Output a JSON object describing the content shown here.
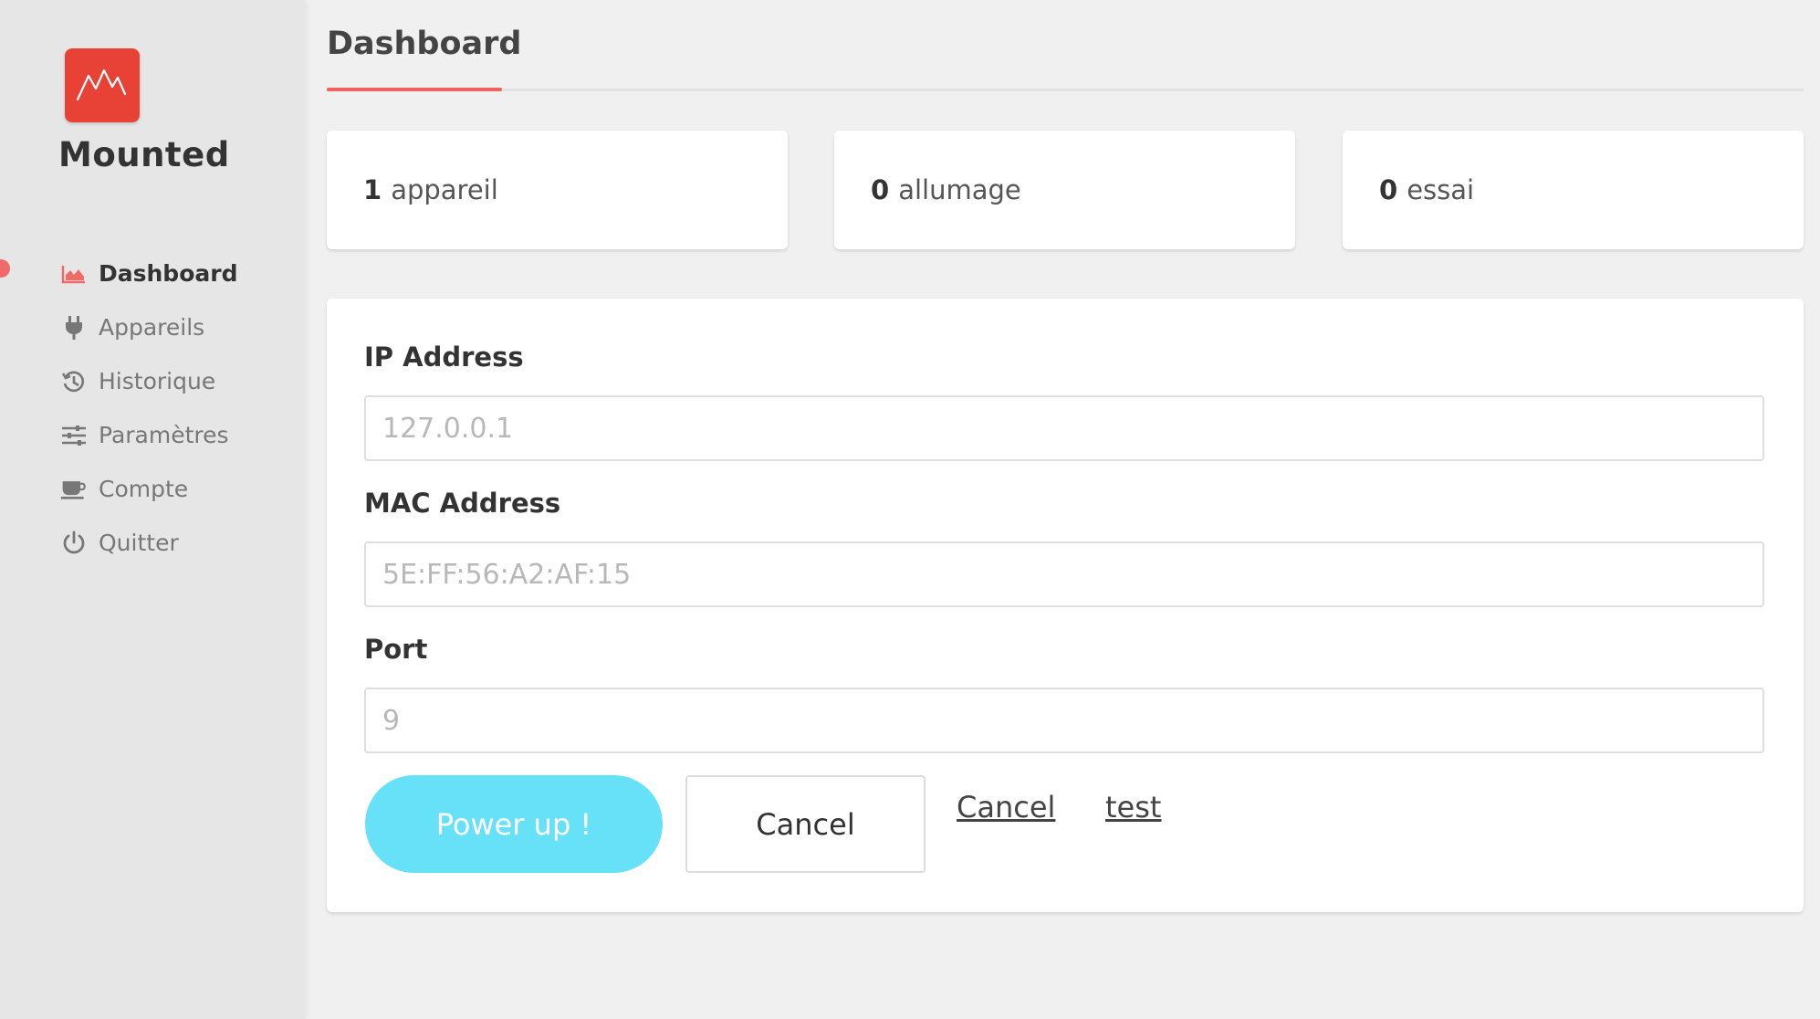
{
  "brand": {
    "name": "Mounted",
    "logo_icon": "mountain-icon",
    "logo_color": "#e84236"
  },
  "sidebar": {
    "items": [
      {
        "label": "Dashboard",
        "icon": "area-chart-icon",
        "active": true
      },
      {
        "label": "Appareils",
        "icon": "plug-icon"
      },
      {
        "label": "Historique",
        "icon": "history-icon"
      },
      {
        "label": "Paramètres",
        "icon": "sliders-icon"
      },
      {
        "label": "Compte",
        "icon": "coffee-cup-icon"
      },
      {
        "label": "Quitter",
        "icon": "power-icon"
      }
    ],
    "active_color": "#f06a6a"
  },
  "header": {
    "title": "Dashboard"
  },
  "stats": [
    {
      "value": "1",
      "label": "appareil"
    },
    {
      "value": "0",
      "label": "allumage"
    },
    {
      "value": "0",
      "label": "essai"
    }
  ],
  "form": {
    "ip": {
      "label": "IP Address",
      "placeholder": "127.0.0.1",
      "value": ""
    },
    "mac": {
      "label": "MAC Address",
      "placeholder": "5E:FF:56:A2:AF:15",
      "value": ""
    },
    "port": {
      "label": "Port",
      "placeholder": "9",
      "value": ""
    },
    "power_button": "Power up !",
    "cancel_button": "Cancel",
    "cancel_link": "Cancel",
    "test_link": "test",
    "power_button_color": "#67e1f8"
  }
}
